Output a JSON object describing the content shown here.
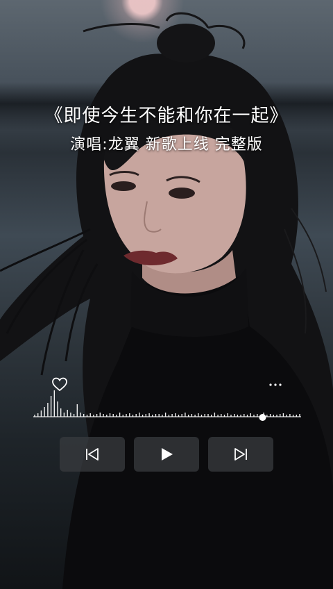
{
  "title": "《即使今生不能和你在一起》",
  "subtitle": "演唱:龙翼  新歌上线  完整版",
  "colors": {
    "text": "#ffffff",
    "button_bg": "#37393d"
  },
  "icons": {
    "like": "heart-outline-icon",
    "more": "more-dots-icon",
    "previous": "skip-previous-icon",
    "play": "play-icon",
    "next": "skip-next-icon"
  },
  "player": {
    "progress": 0.86
  }
}
